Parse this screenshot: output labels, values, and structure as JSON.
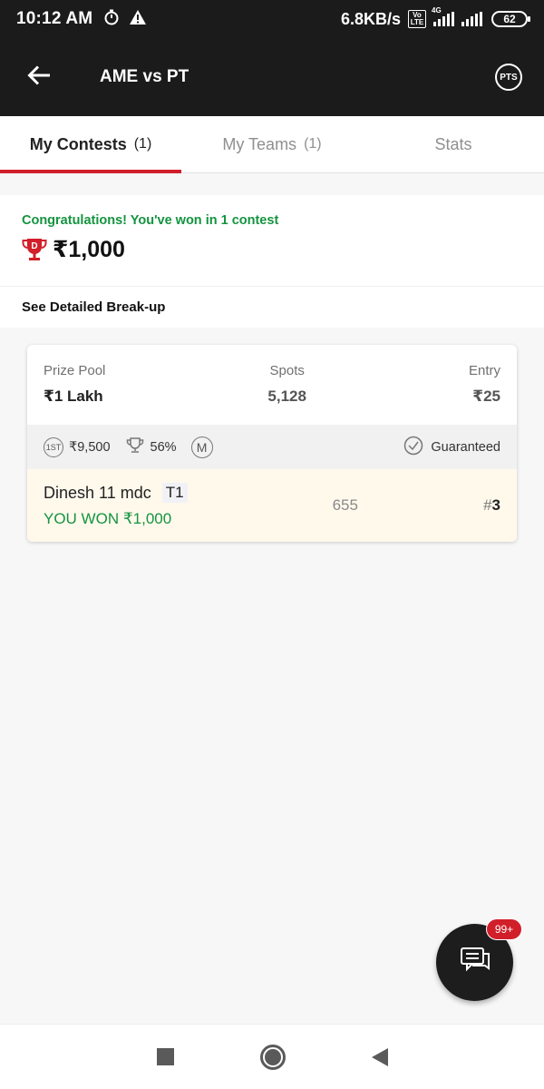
{
  "status_bar": {
    "time": "10:12 AM",
    "net_speed": "6.8KB/s",
    "volte": "Vo LTE",
    "net_type": "4G",
    "battery": "62",
    "icons": [
      "timer-icon",
      "warning-icon",
      "volte-icon",
      "signal-icon",
      "battery-icon"
    ]
  },
  "header": {
    "title": "AME vs PT",
    "back_icon": "arrow-left-icon",
    "pts_label": "PTS"
  },
  "tabs": [
    {
      "label": "My Contests",
      "count": "(1)",
      "active": true
    },
    {
      "label": "My Teams",
      "count": "(1)",
      "active": false
    },
    {
      "label": "Stats",
      "count": "",
      "active": false
    }
  ],
  "winnings": {
    "congrats_text": "Congratulations! You've won in 1 contest",
    "amount": "₹1,000",
    "trophy_icon": "dream11-trophy-icon"
  },
  "breakup": {
    "label": "See Detailed Break-up"
  },
  "contest": {
    "prize_pool_label": "Prize Pool",
    "prize_pool_value": "₹1 Lakh",
    "spots_label": "Spots",
    "spots_value": "5,128",
    "entry_label": "Entry",
    "entry_value": "₹25",
    "first_prize": "₹9,500",
    "first_prize_icon_label": "1ST",
    "winners_percent": "56%",
    "multi_entry_label": "M",
    "guaranteed_label": "Guaranteed",
    "team_name": "Dinesh 11 mdc",
    "team_tag": "T1",
    "won_text": "YOU WON ₹1,000",
    "points": "655",
    "rank_hash": "#",
    "rank": "3"
  },
  "fab": {
    "badge": "99+",
    "icon": "chat-icon"
  },
  "colors": {
    "header_bg": "#1b1b1b",
    "accent_red": "#d11f2a",
    "success_green": "#14943f",
    "highlight_row": "#fff9ec"
  }
}
